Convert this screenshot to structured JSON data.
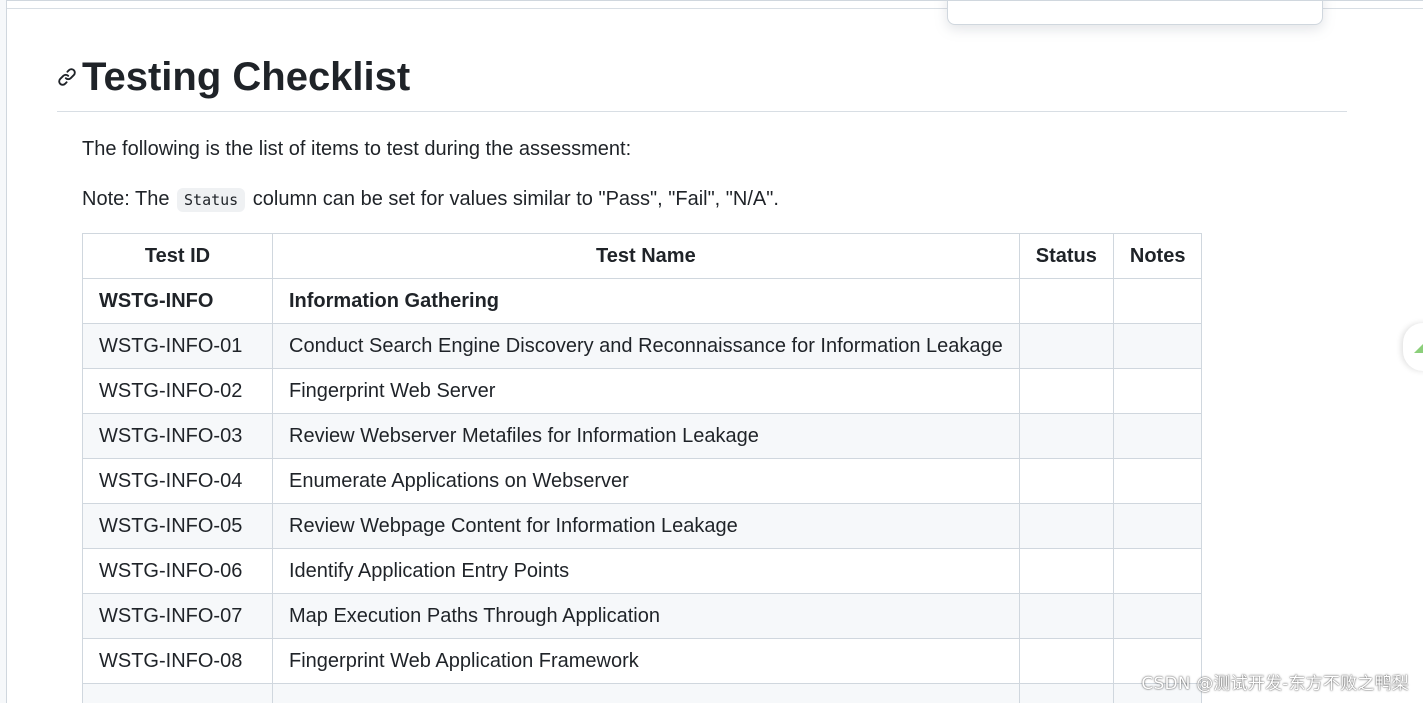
{
  "heading": "Testing Checklist",
  "intro": "The following is the list of items to test during the assessment:",
  "note": {
    "prefix": "Note: The",
    "code": "Status",
    "suffix": "column can be set for values similar to \"Pass\", \"Fail\", \"N/A\"."
  },
  "table": {
    "headers": [
      "Test ID",
      "Test Name",
      "Status",
      "Notes"
    ],
    "rows": [
      {
        "id": "WSTG-INFO",
        "name": "Information Gathering",
        "status": "",
        "notes": "",
        "section": true
      },
      {
        "id": "WSTG-INFO-01",
        "name": "Conduct Search Engine Discovery and Reconnaissance for Information Leakage",
        "status": "",
        "notes": ""
      },
      {
        "id": "WSTG-INFO-02",
        "name": "Fingerprint Web Server",
        "status": "",
        "notes": ""
      },
      {
        "id": "WSTG-INFO-03",
        "name": "Review Webserver Metafiles for Information Leakage",
        "status": "",
        "notes": ""
      },
      {
        "id": "WSTG-INFO-04",
        "name": "Enumerate Applications on Webserver",
        "status": "",
        "notes": ""
      },
      {
        "id": "WSTG-INFO-05",
        "name": "Review Webpage Content for Information Leakage",
        "status": "",
        "notes": ""
      },
      {
        "id": "WSTG-INFO-06",
        "name": "Identify Application Entry Points",
        "status": "",
        "notes": ""
      },
      {
        "id": "WSTG-INFO-07",
        "name": "Map Execution Paths Through Application",
        "status": "",
        "notes": ""
      },
      {
        "id": "WSTG-INFO-08",
        "name": "Fingerprint Web Application Framework",
        "status": "",
        "notes": ""
      }
    ]
  },
  "watermark": "CSDN @测试开发-东方不败之鸭梨",
  "icons": {
    "anchor": "link-icon"
  }
}
